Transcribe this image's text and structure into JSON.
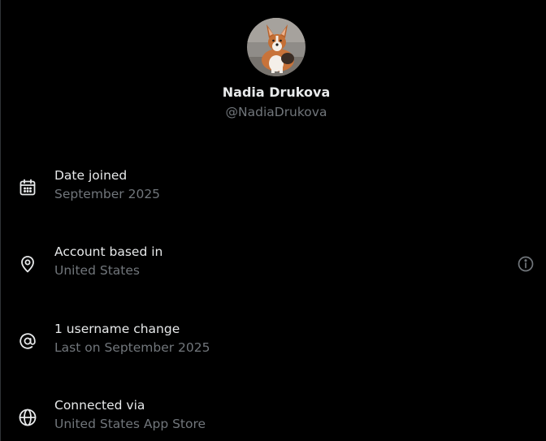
{
  "profile": {
    "name": "Nadia Drukova",
    "handle": "@NadiaDrukova",
    "avatar_icon": "corgi-avatar"
  },
  "rows": [
    {
      "icon": "calendar-icon",
      "title": "Date joined",
      "subtitle": "September 2025"
    },
    {
      "icon": "location-pin-icon",
      "title": "Account based in",
      "subtitle": "United States",
      "trailing_icon": "info-icon"
    },
    {
      "icon": "at-sign-icon",
      "title": "1 username change",
      "subtitle": "Last on September 2025"
    },
    {
      "icon": "globe-icon",
      "title": "Connected via",
      "subtitle": "United States App Store"
    }
  ],
  "colors": {
    "background": "#000000",
    "primary_text": "#e7e9ea",
    "secondary_text": "#71767b"
  }
}
